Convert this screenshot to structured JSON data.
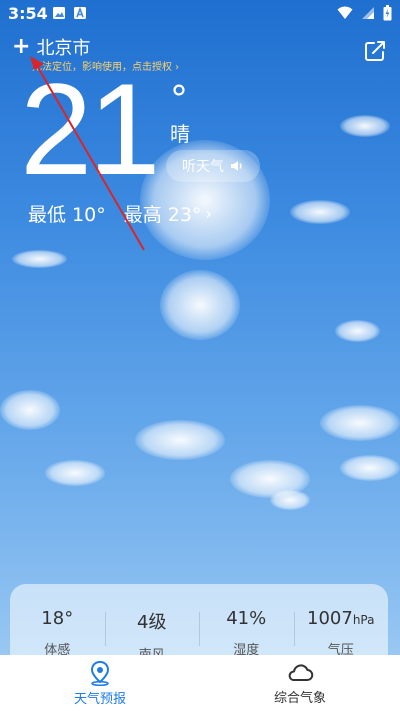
{
  "status_bar": {
    "time": "3:54"
  },
  "location": {
    "add_symbol": "+",
    "city": "北京市",
    "warning": "无法定位，影响使用，点击授权 ›"
  },
  "weather": {
    "temperature": "21",
    "degree_symbol": "°",
    "condition": "晴",
    "listen_label": "听天气",
    "low": "最低 10°",
    "high": "最高 23°",
    "chevron": "›"
  },
  "details": [
    {
      "value": "18°",
      "unit": "",
      "label": "体感"
    },
    {
      "value": "4级",
      "unit": "",
      "label": "南风"
    },
    {
      "value": "41%",
      "unit": "",
      "label": "湿度"
    },
    {
      "value": "1007",
      "unit": "hPa",
      "label": "气压"
    }
  ],
  "tabs": [
    {
      "label": "天气预报",
      "icon": "location-pin-icon",
      "active": true
    },
    {
      "label": "综合气象",
      "icon": "cloud-icon",
      "active": false
    }
  ],
  "colors": {
    "accent": "#1e7bea",
    "warning": "#ffd26a",
    "annotation_arrow": "#d9252a"
  }
}
